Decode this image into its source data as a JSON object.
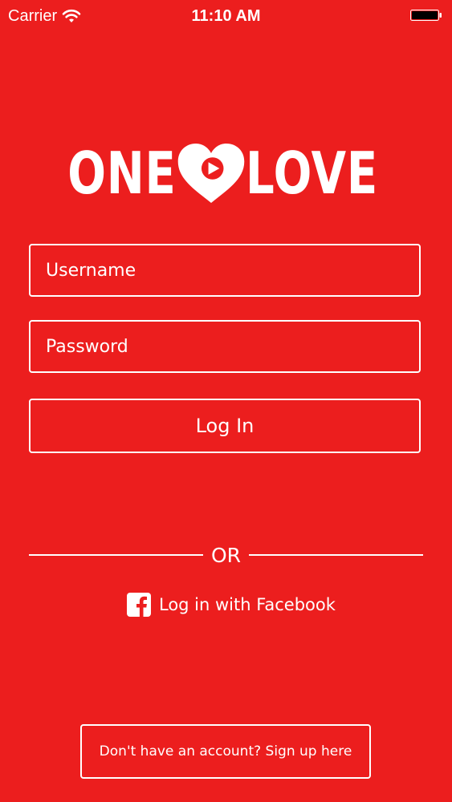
{
  "status_bar": {
    "carrier": "Carrier",
    "time": "11:10 AM",
    "icons": [
      "wifi-icon",
      "battery-icon"
    ]
  },
  "logo": {
    "left_word": "ONE",
    "right_word": "LOVE",
    "icon": "heart-play-icon"
  },
  "form": {
    "username": {
      "placeholder": "Username",
      "value": ""
    },
    "password": {
      "placeholder": "Password",
      "value": ""
    },
    "login_label": "Log In"
  },
  "divider": {
    "label": "OR"
  },
  "facebook": {
    "label": "Log in with Facebook",
    "icon": "facebook-icon"
  },
  "signup": {
    "label": "Don't have an account? Sign up here"
  },
  "colors": {
    "background": "#ec1e1e",
    "foreground": "#ffffff"
  }
}
